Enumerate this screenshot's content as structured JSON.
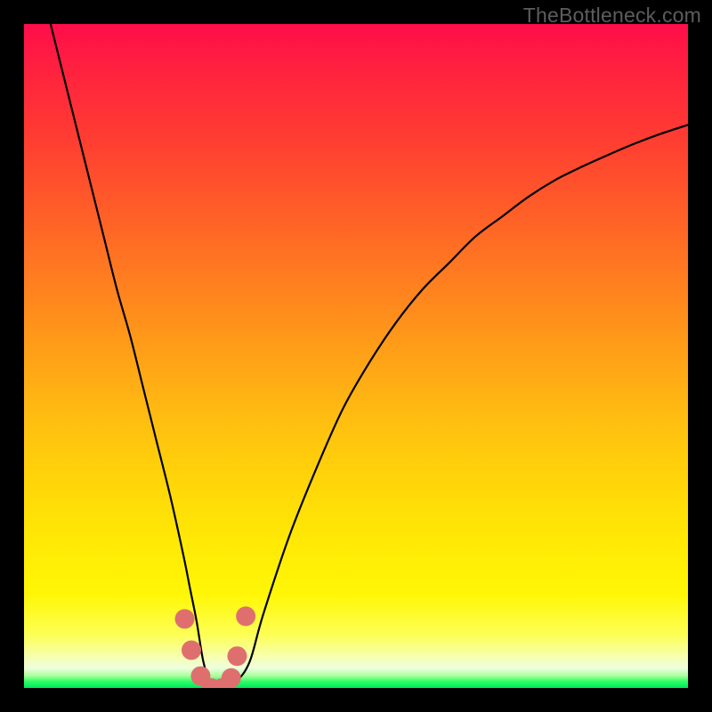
{
  "watermark": "TheBottleneck.com",
  "chart_data": {
    "type": "line",
    "title": "",
    "xlabel": "",
    "ylabel": "",
    "xlim": [
      0,
      100
    ],
    "ylim": [
      0,
      100
    ],
    "grid": false,
    "legend": false,
    "annotations": [],
    "series": [
      {
        "name": "bottleneck-curve",
        "color": "#000000",
        "x": [
          4,
          6,
          8,
          10,
          12,
          14,
          16,
          18,
          20,
          22,
          24,
          25,
          26,
          27,
          28,
          29,
          30,
          32,
          34,
          36,
          40,
          44,
          48,
          52,
          56,
          60,
          64,
          68,
          72,
          76,
          80,
          84,
          88,
          92,
          96,
          100
        ],
        "values": [
          100,
          92,
          84,
          76,
          68,
          60,
          53,
          45,
          37,
          29,
          20,
          15,
          10,
          4,
          1,
          0,
          0,
          1,
          4,
          11,
          23,
          33,
          42,
          49,
          55,
          60,
          64,
          68,
          71,
          74,
          76.5,
          78.5,
          80.3,
          82,
          83.5,
          84.8
        ]
      }
    ],
    "markers": {
      "name": "valley-markers",
      "color": "#df6f6f",
      "points": [
        {
          "x": 24.2,
          "y": 10.4
        },
        {
          "x": 25.2,
          "y": 5.7
        },
        {
          "x": 26.6,
          "y": 1.8
        },
        {
          "x": 28.2,
          "y": 0.0
        },
        {
          "x": 29.8,
          "y": 0.0
        },
        {
          "x": 31.2,
          "y": 1.5
        },
        {
          "x": 32.1,
          "y": 4.8
        },
        {
          "x": 33.4,
          "y": 10.8
        }
      ]
    }
  }
}
